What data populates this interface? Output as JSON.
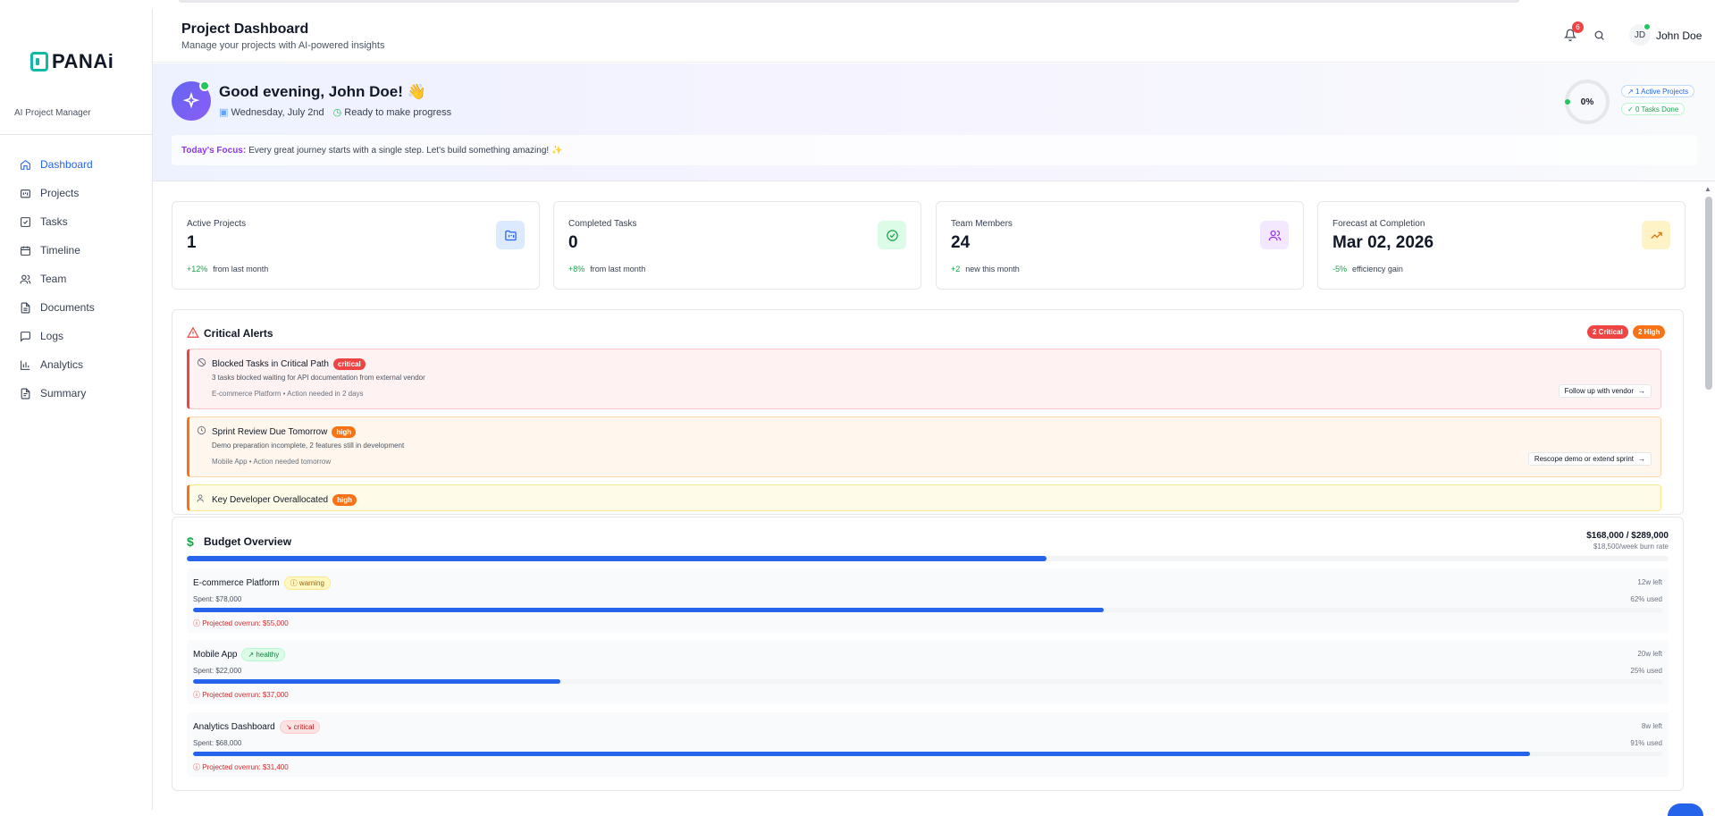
{
  "brand": {
    "name": "PANAi",
    "tagline": "AI Project Manager"
  },
  "nav": [
    {
      "label": "Dashboard",
      "icon": "home-icon",
      "active": true
    },
    {
      "label": "Projects",
      "icon": "folder-kanban-icon"
    },
    {
      "label": "Tasks",
      "icon": "checkbox-icon"
    },
    {
      "label": "Timeline",
      "icon": "calendar-icon"
    },
    {
      "label": "Team",
      "icon": "users-icon"
    },
    {
      "label": "Documents",
      "icon": "file-icon"
    },
    {
      "label": "Logs",
      "icon": "message-square-icon"
    },
    {
      "label": "Analytics",
      "icon": "bar-chart-icon"
    },
    {
      "label": "Summary",
      "icon": "file-text-icon"
    }
  ],
  "header": {
    "title": "Project Dashboard",
    "subtitle": "Manage your projects with AI-powered insights",
    "notification_count": "6",
    "user_initials": "JD",
    "user_name": "John Doe"
  },
  "greeting": {
    "title": "Good evening, John Doe! 👋",
    "date": "Wednesday, July 2nd",
    "status": "Ready to make progress",
    "progress": "0%",
    "active_projects": "1 Active Projects",
    "tasks_done": "0 Tasks Done",
    "focus_label": "Today's Focus:",
    "focus_text": "Every great journey starts with a single step. Let's build something amazing! ✨"
  },
  "stats": [
    {
      "label": "Active Projects",
      "value": "1",
      "change": "+12%",
      "change_note": "from last month",
      "icon": "folder-icon",
      "color": "#2563eb"
    },
    {
      "label": "Completed Tasks",
      "value": "0",
      "change": "+8%",
      "change_note": "from last month",
      "icon": "check-circle-icon",
      "color": "#16a34a"
    },
    {
      "label": "Team Members",
      "value": "24",
      "change": "+2",
      "change_note": "new this month",
      "icon": "users-icon",
      "color": "#9333ea"
    },
    {
      "label": "Forecast at Completion",
      "value": "Mar 02, 2026",
      "change": "-5%",
      "change_note": "efficiency gain",
      "icon": "trending-up-icon",
      "color": "#d97706"
    }
  ],
  "alerts": {
    "title": "Critical Alerts",
    "critical_count": "2 Critical",
    "high_count": "2 High",
    "items": [
      {
        "title": "Blocked Tasks in Critical Path",
        "severity": "critical",
        "description": "3 tasks blocked waiting for API documentation from external vendor",
        "meta": "E-commerce Platform • Action needed in 2 days",
        "action": "Follow up with vendor"
      },
      {
        "title": "Sprint Review Due Tomorrow",
        "severity": "high",
        "description": "Demo preparation incomplete, 2 features still in development",
        "meta": "Mobile App • Action needed tomorrow",
        "action": "Rescope demo or extend sprint"
      },
      {
        "title": "Key Developer Overallocated",
        "severity": "high"
      }
    ]
  },
  "budget": {
    "title": "Budget Overview",
    "total": "$168,000 / $289,000",
    "burn_rate": "$18,500/week burn rate",
    "overall_fraction": 0.58,
    "items": [
      {
        "name": "E-commerce Platform",
        "status": "warning",
        "spent": "Spent: $78,000",
        "time_left": "12w left",
        "used": "62% used",
        "used_fraction": 0.62,
        "overrun": "Projected overrun: $55,000"
      },
      {
        "name": "Mobile App",
        "status": "healthy",
        "spent": "Spent: $22,000",
        "time_left": "20w left",
        "used": "25% used",
        "used_fraction": 0.25,
        "overrun": "Projected overrun: $37,000"
      },
      {
        "name": "Analytics Dashboard",
        "status": "critical",
        "spent": "Spent: $68,000",
        "time_left": "8w left",
        "used": "91% used",
        "used_fraction": 0.91,
        "overrun": "Projected overrun: $31,400"
      }
    ]
  }
}
